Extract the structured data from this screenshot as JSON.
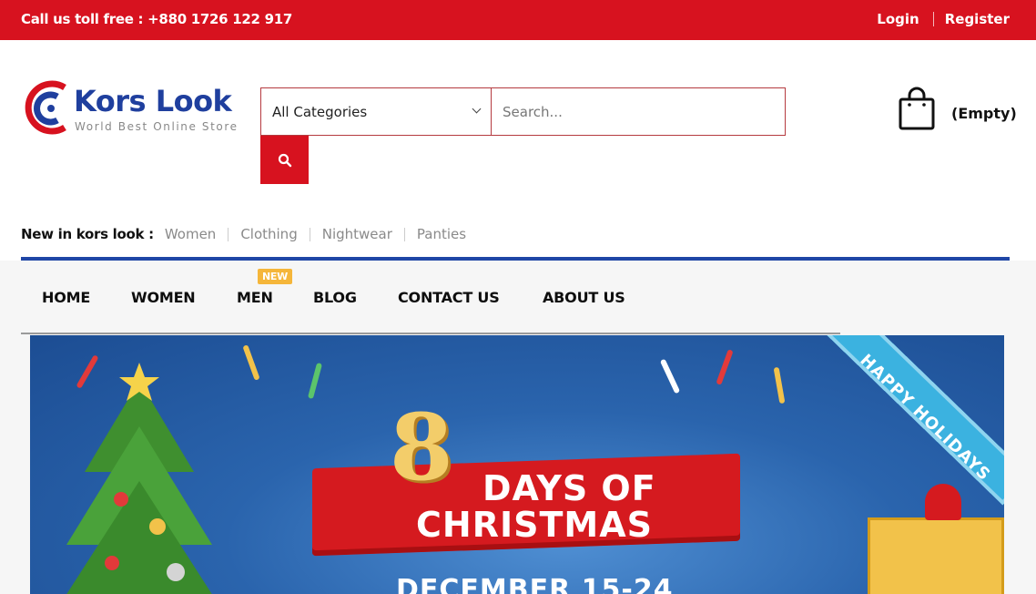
{
  "topbar": {
    "phone": "Call us toll free : +880 1726 122 917",
    "login": "Login",
    "register": "Register",
    "bg_color": "#d7121f"
  },
  "logo": {
    "name": "Kors Look",
    "tagline": "World Best Online Store"
  },
  "search": {
    "category_selected": "All Categories",
    "placeholder": "Search...",
    "button_icon": "search-icon"
  },
  "cart": {
    "icon": "shopping-bag-icon",
    "status": "(Empty)"
  },
  "new_in": {
    "label": "New in kors look :",
    "links": [
      "Women",
      "Clothing",
      "Nightwear",
      "Panties"
    ]
  },
  "nav": {
    "items": [
      "HOME",
      "WOMEN",
      "MEN",
      "BLOG",
      "CONTACT US",
      "ABOUT US"
    ],
    "badge": "NEW"
  },
  "banner": {
    "number": "8",
    "line1": "DAYS OF",
    "line2": "CHRISTMAS",
    "line3": "DECEMBER 15-24",
    "corner": "HAPPY HOLIDAYS"
  },
  "colors": {
    "brand_red": "#d7121f",
    "brand_blue": "#1f46a6",
    "badge": "#f5b63a"
  }
}
